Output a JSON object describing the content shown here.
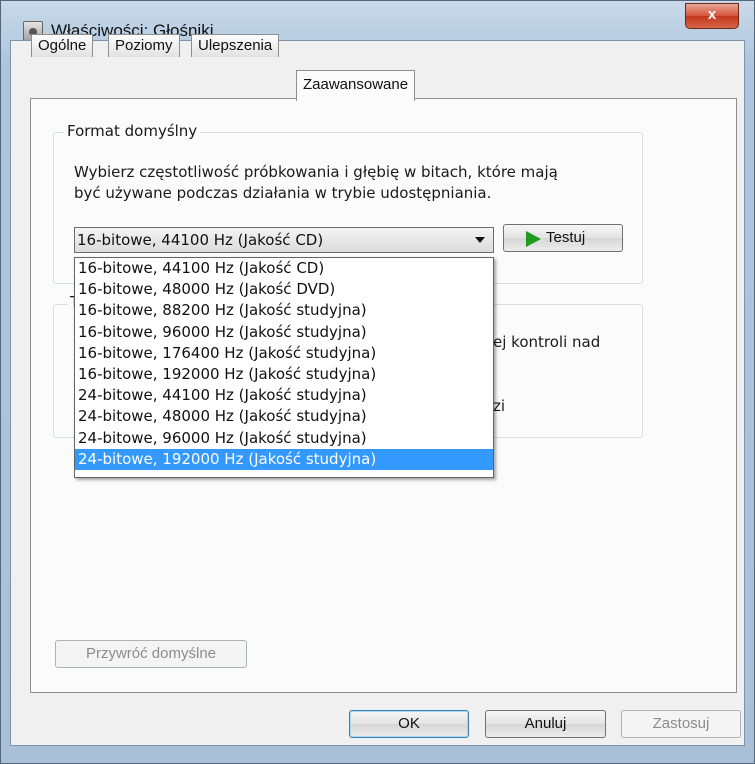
{
  "window": {
    "title": "Właściwości: Głośniki",
    "close_label": "x"
  },
  "tabs": [
    {
      "label": "Ogólne"
    },
    {
      "label": "Poziomy"
    },
    {
      "label": "Ulepszenia"
    },
    {
      "label": "Zaawansowane"
    }
  ],
  "default_format": {
    "group_label": "Format domyślny",
    "description_line1": "Wybierz częstotliwość próbkowania i głębię w bitach, które mają",
    "description_line2": "być używane podczas działania w trybie udostępniania.",
    "selected": "16-bitowe, 44100 Hz (Jakość CD)",
    "test_button": "Testuj",
    "options": [
      "16-bitowe, 44100 Hz (Jakość CD)",
      "16-bitowe, 48000 Hz (Jakość DVD)",
      "16-bitowe, 88200 Hz (Jakość studyjna)",
      "16-bitowe, 96000 Hz (Jakość studyjna)",
      "16-bitowe, 176400 Hz (Jakość studyjna)",
      "16-bitowe, 192000 Hz (Jakość studyjna)",
      "24-bitowe, 44100 Hz (Jakość studyjna)",
      "24-bitowe, 48000 Hz (Jakość studyjna)",
      "24-bitowe, 96000 Hz (Jakość studyjna)",
      "24-bitowe, 192000 Hz (Jakość studyjna)"
    ],
    "highlighted_index": 9
  },
  "exclusive_group": {
    "label_fragment": "T",
    "text_fragment1": "ej kontroli nad",
    "text_fragment2": "zi"
  },
  "restore_button": "Przywróć domyślne",
  "footer": {
    "ok": "OK",
    "cancel": "Anuluj",
    "apply": "Zastosuj"
  },
  "colors": {
    "highlight": "#3399ff",
    "play_icon": "#1f9b1f",
    "close_button": "#c2381f"
  }
}
